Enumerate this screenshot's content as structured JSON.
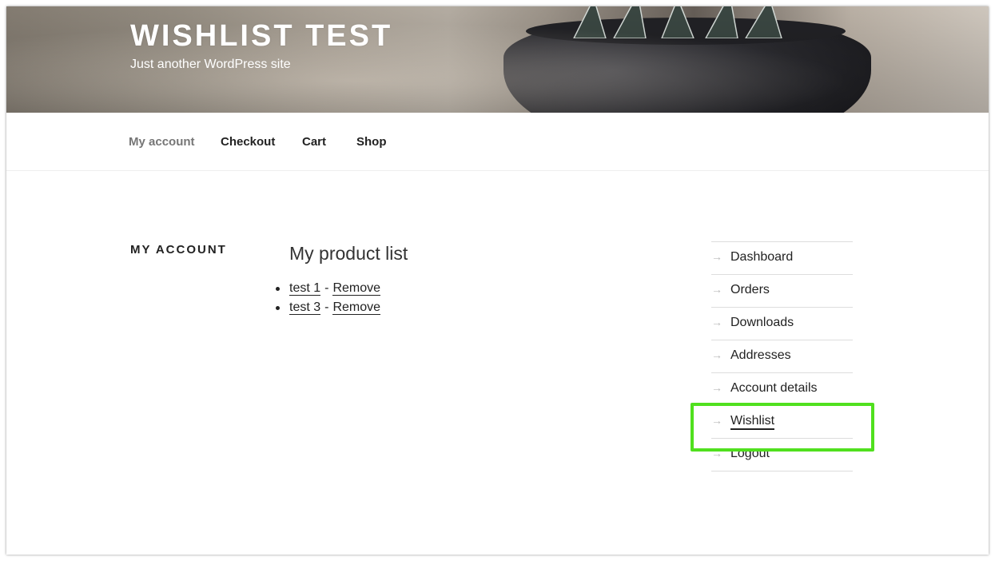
{
  "site": {
    "title": "WISHLIST TEST",
    "tagline": "Just another WordPress site"
  },
  "nav": {
    "items": [
      {
        "label": "My account",
        "current": true
      },
      {
        "label": "Checkout",
        "current": false
      },
      {
        "label": "Cart",
        "current": false
      },
      {
        "label": "Shop",
        "current": false
      }
    ]
  },
  "page": {
    "title": "MY ACCOUNT"
  },
  "content": {
    "heading": "My product list",
    "products": [
      {
        "name": "test 1",
        "separator": "-",
        "action": "Remove"
      },
      {
        "name": "test 3",
        "separator": "-",
        "action": "Remove"
      }
    ]
  },
  "account_nav": {
    "arrow": "→",
    "items": [
      {
        "label": "Dashboard",
        "active": false
      },
      {
        "label": "Orders",
        "active": false
      },
      {
        "label": "Downloads",
        "active": false
      },
      {
        "label": "Addresses",
        "active": false
      },
      {
        "label": "Account details",
        "active": false
      },
      {
        "label": "Wishlist",
        "active": true
      },
      {
        "label": "Logout",
        "active": false
      }
    ]
  },
  "colors": {
    "highlight": "#50e01e",
    "text": "#222222",
    "muted_nav": "#767676",
    "divider": "#dddddd"
  }
}
